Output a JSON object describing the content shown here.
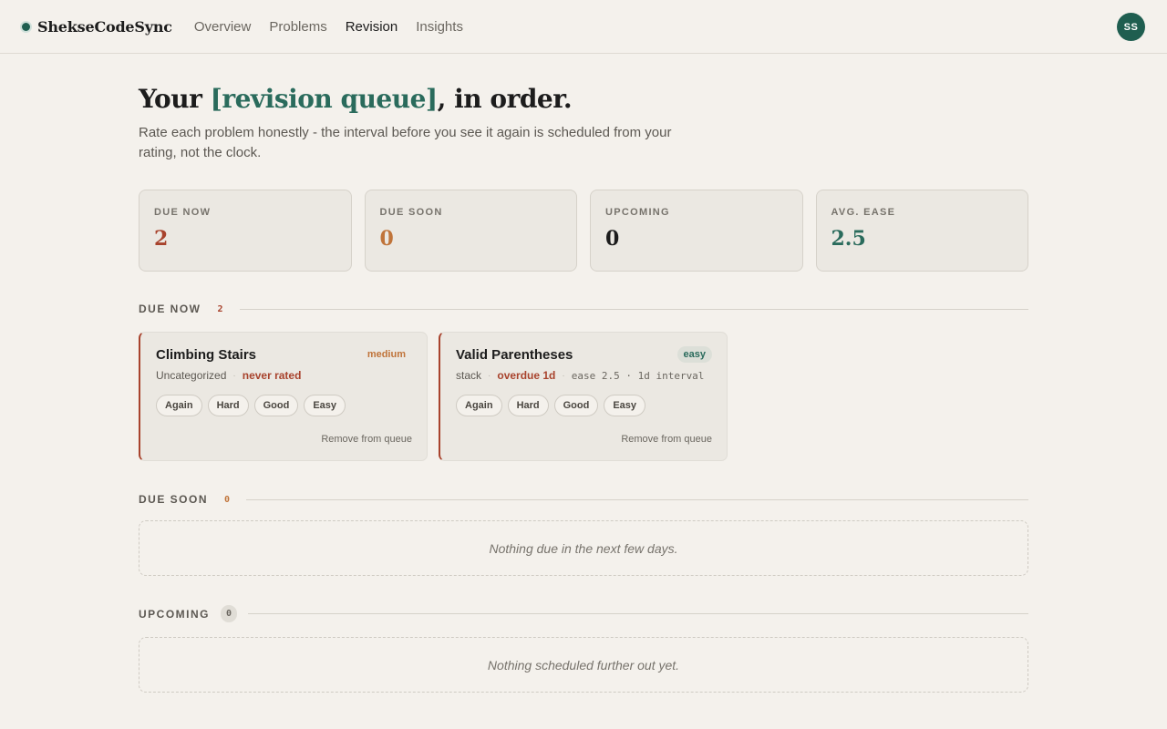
{
  "app": {
    "brand": "ShekseCodeSync",
    "avatar_initials": "SS"
  },
  "nav": {
    "items": [
      {
        "label": "Overview",
        "active": false
      },
      {
        "label": "Problems",
        "active": false
      },
      {
        "label": "Revision",
        "active": true
      },
      {
        "label": "Insights",
        "active": false
      }
    ]
  },
  "hero": {
    "title_prefix": "Your ",
    "title_accent": "[revision queue]",
    "title_suffix": ", in order.",
    "subtitle": "Rate each problem honestly - the interval before you see it again is scheduled from your rating, not the clock."
  },
  "stats": [
    {
      "label": "DUE NOW",
      "value": "2",
      "color": "#a8432d"
    },
    {
      "label": "DUE SOON",
      "value": "0",
      "color": "#c0743a"
    },
    {
      "label": "UPCOMING",
      "value": "0",
      "color": "#1c1c1c"
    },
    {
      "label": "AVG. EASE",
      "value": "2.5",
      "color": "#2a6b5c"
    }
  ],
  "sections": {
    "due_now": {
      "title": "DUE NOW",
      "count": "2",
      "cards": [
        {
          "title": "Climbing Stairs",
          "difficulty": "medium",
          "category": "Uncategorized",
          "status": "never rated",
          "extra": "",
          "ratings": [
            "Again",
            "Hard",
            "Good",
            "Easy"
          ],
          "remove_label": "Remove from queue"
        },
        {
          "title": "Valid Parentheses",
          "difficulty": "easy",
          "category": "stack",
          "status": "overdue 1d",
          "extra": "ease 2.5 · 1d interval",
          "ratings": [
            "Again",
            "Hard",
            "Good",
            "Easy"
          ],
          "remove_label": "Remove from queue"
        }
      ]
    },
    "due_soon": {
      "title": "DUE SOON",
      "count": "0",
      "empty_text": "Nothing due in the next few days."
    },
    "upcoming": {
      "title": "UPCOMING",
      "count": "0",
      "empty_text": "Nothing scheduled further out yet."
    }
  },
  "colors": {
    "accent": "#2a6b5c",
    "danger": "#a8432d",
    "warning": "#c0743a",
    "background": "#f4f1ec"
  }
}
